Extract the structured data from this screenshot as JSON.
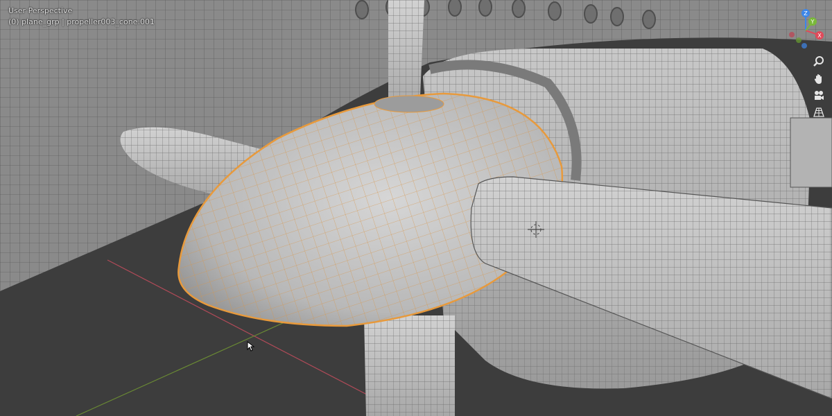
{
  "viewport": {
    "view_name": "User Perspective",
    "object_path": "(0) plane_grp | propeller003_cone.001",
    "colors": {
      "background": "#3d3d3d",
      "mesh_fill": "#bcbcbc",
      "wire": "#6a6a6a",
      "selection_outline": "#e89a3c",
      "x_axis": "#b04a58",
      "y_axis": "#6a8a34"
    }
  },
  "gizmo": {
    "z_label": "Z",
    "y_label": "Y",
    "x_label": "X",
    "x_color": "#e04a5a",
    "y_color": "#7ab83a",
    "z_color": "#3d86e8"
  },
  "nav_tools": [
    "zoom-icon",
    "pan-hand-icon",
    "camera-view-icon",
    "perspective-grid-icon"
  ]
}
